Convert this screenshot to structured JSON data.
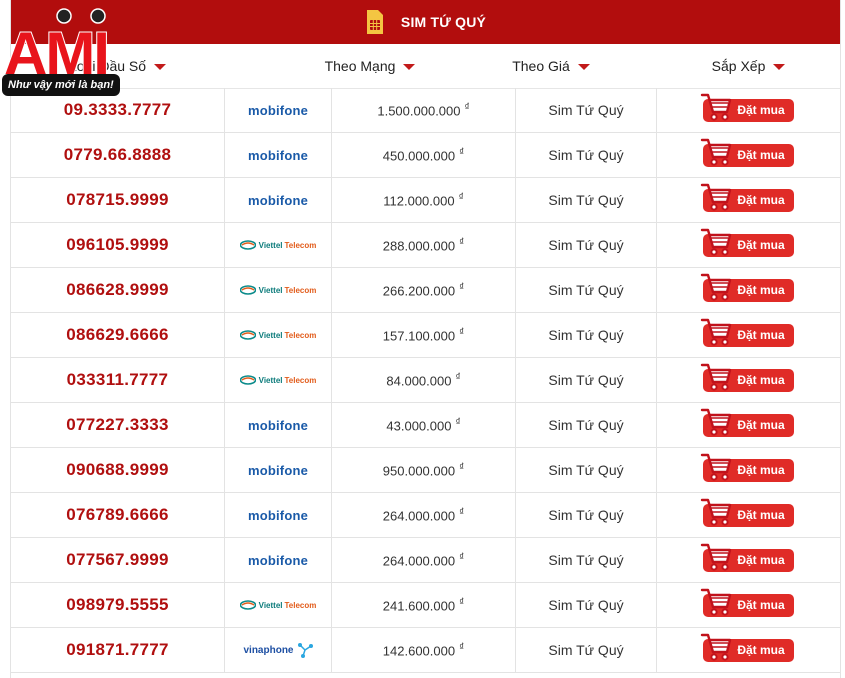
{
  "banner": {
    "title": "SIM TỨ QUÝ"
  },
  "logo": {
    "brand": "AMI",
    "slogan": "Như vậy mới là bạn!"
  },
  "header": {
    "col1": "Loại Đầu Số",
    "col2": "Theo Mạng",
    "col3": "Theo Giá",
    "col4": "Sắp Xếp"
  },
  "currency_symbol": "₫",
  "buy_label": "Đặt mua",
  "rows": [
    {
      "number": "09.3333.7777",
      "network": "mobifone",
      "price": "1.500.000.000",
      "type": "Sim Tứ Quý"
    },
    {
      "number": "0779.66.8888",
      "network": "mobifone",
      "price": "450.000.000",
      "type": "Sim Tứ Quý"
    },
    {
      "number": "078715.9999",
      "network": "mobifone",
      "price": "112.000.000",
      "type": "Sim Tứ Quý"
    },
    {
      "number": "096105.9999",
      "network": "viettel",
      "price": "288.000.000",
      "type": "Sim Tứ Quý"
    },
    {
      "number": "086628.9999",
      "network": "viettel",
      "price": "266.200.000",
      "type": "Sim Tứ Quý"
    },
    {
      "number": "086629.6666",
      "network": "viettel",
      "price": "157.100.000",
      "type": "Sim Tứ Quý"
    },
    {
      "number": "033311.7777",
      "network": "viettel",
      "price": "84.000.000",
      "type": "Sim Tứ Quý"
    },
    {
      "number": "077227.3333",
      "network": "mobifone",
      "price": "43.000.000",
      "type": "Sim Tứ Quý"
    },
    {
      "number": "090688.9999",
      "network": "mobifone",
      "price": "950.000.000",
      "type": "Sim Tứ Quý"
    },
    {
      "number": "076789.6666",
      "network": "mobifone",
      "price": "264.000.000",
      "type": "Sim Tứ Quý"
    },
    {
      "number": "077567.9999",
      "network": "mobifone",
      "price": "264.000.000",
      "type": "Sim Tứ Quý"
    },
    {
      "number": "098979.5555",
      "network": "viettel",
      "price": "241.600.000",
      "type": "Sim Tứ Quý"
    },
    {
      "number": "091871.7777",
      "network": "vinaphone",
      "price": "142.600.000",
      "type": "Sim Tứ Quý"
    }
  ],
  "networks": {
    "mobifone": {
      "label": "mobifone"
    },
    "viettel": {
      "label": "Viettel",
      "suffix": "Telecom"
    },
    "vinaphone": {
      "label": "vinaphone"
    }
  },
  "colors": {
    "brand_red": "#b20d0d",
    "number_red": "#b00f0f",
    "button_red": "#e02b27"
  }
}
